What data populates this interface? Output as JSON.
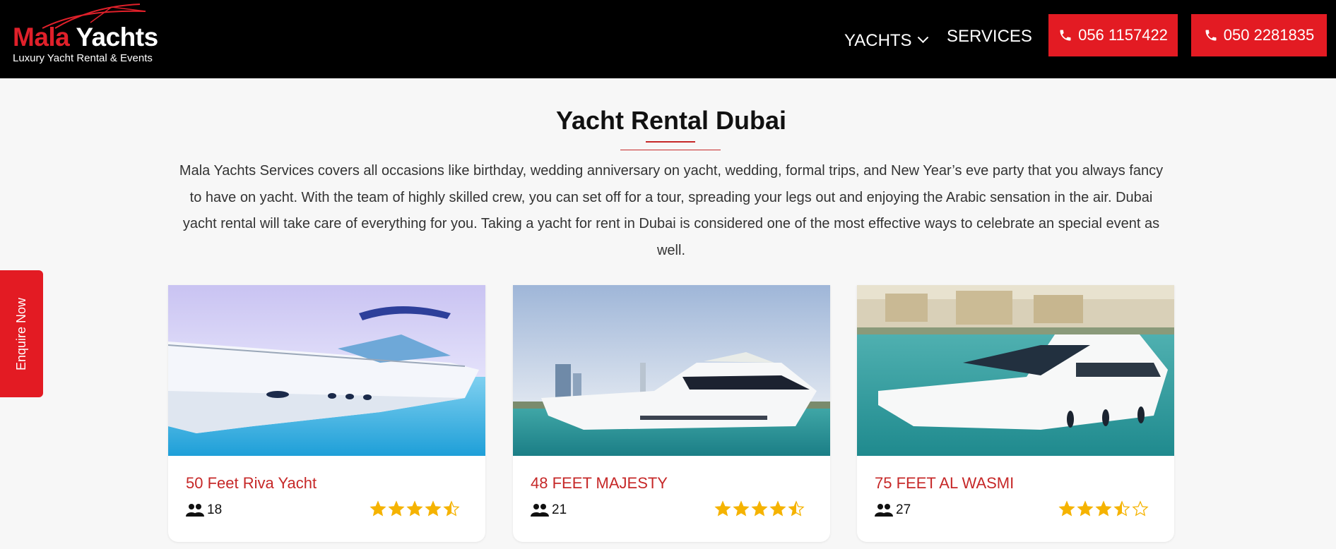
{
  "header": {
    "logo": {
      "brand_part1": "Mala",
      "brand_part2": "Yachts",
      "tagline": "Luxury Yacht Rental & Events"
    },
    "nav": {
      "yachts_label": "YACHTS",
      "services_label": "SERVICES"
    },
    "phones": [
      {
        "number": "056 1157422",
        "icon": "phone-icon"
      },
      {
        "number": "050 2281835",
        "icon": "phone-icon"
      }
    ]
  },
  "main": {
    "title": "Yacht Rental Dubai",
    "intro": "Mala Yachts Services covers all occasions like birthday, wedding anniversary on yacht, wedding, formal trips, and New Year’s eve party that you always fancy to have on yacht. With the team of highly skilled crew, you can set off for a tour, spreading your legs out and enjoying the Arabic sensation in the air. Dubai yacht rental will take care of everything for you. Taking a yacht for rent in Dubai is considered one of the most effective ways to celebrate an special event as well."
  },
  "side_tab": {
    "label": "Enquire Now"
  },
  "cards": [
    {
      "name": "50 Feet Riva Yacht",
      "capacity": "18",
      "rating": 4.5
    },
    {
      "name": "48 FEET MAJESTY",
      "capacity": "21",
      "rating": 4.5
    },
    {
      "name": "75 FEET AL WASMI",
      "capacity": "27",
      "rating": 3.5
    }
  ],
  "colors": {
    "accent": "#e31b23",
    "title_red": "#c62828",
    "star": "#f5b301",
    "header_bg": "#000000"
  },
  "icons": {
    "capacity": "users-icon",
    "rating": "star-icon"
  }
}
